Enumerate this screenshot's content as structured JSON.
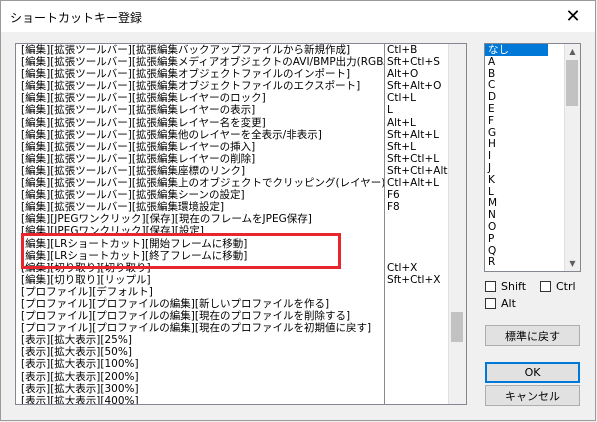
{
  "window": {
    "title": "ショートカットキー登録",
    "close_glyph": "✕"
  },
  "commands": [
    {
      "cmd": "[編集][拡張ツールバー][拡張編集バックアップファイルから新規作成]",
      "key": "Ctl+B"
    },
    {
      "cmd": "[編集][拡張ツールバー][拡張編集メディアオブジェクトのAVI/BMP出力(RGBA)]",
      "key": "Sft+Ctl+S"
    },
    {
      "cmd": "[編集][拡張ツールバー][拡張編集オブジェクトファイルのインポート]",
      "key": "Alt+O"
    },
    {
      "cmd": "[編集][拡張ツールバー][拡張編集オブジェクトファイルのエクスポート]",
      "key": "Sft+Alt+O"
    },
    {
      "cmd": "[編集][拡張ツールバー][拡張編集レイヤーのロック]",
      "key": "Ctl+L"
    },
    {
      "cmd": "[編集][拡張ツールバー][拡張編集レイヤーの表示]",
      "key": "L"
    },
    {
      "cmd": "[編集][拡張ツールバー][拡張編集レイヤー名を変更]",
      "key": "Alt+L"
    },
    {
      "cmd": "[編集][拡張ツールバー][拡張編集他のレイヤーを全表示/非表示]",
      "key": "Sft+Alt+L"
    },
    {
      "cmd": "[編集][拡張ツールバー][拡張編集レイヤーの挿入]",
      "key": "Sft+L"
    },
    {
      "cmd": "[編集][拡張ツールバー][拡張編集レイヤーの削除]",
      "key": "Sft+Ctl+L"
    },
    {
      "cmd": "[編集][拡張ツールバー][拡張編集座標のリンク]",
      "key": "Sft+Ctl+Alt+"
    },
    {
      "cmd": "[編集][拡張ツールバー][拡張編集上のオブジェクトでクリッピング(レイヤー)]",
      "key": "Ctl+Alt+L"
    },
    {
      "cmd": "[編集][拡張ツールバー][拡張編集シーンの設定]",
      "key": "F6"
    },
    {
      "cmd": "[編集][拡張ツールバー][拡張編集環境設定]",
      "key": "F8"
    },
    {
      "cmd": "[編集][JPEGワンクリック][保存][現在のフレームをJPEG保存]",
      "key": ""
    },
    {
      "cmd": "[編集][JPEGワンクリック][保存][設定]",
      "key": ""
    },
    {
      "cmd": "[編集][LRショートカット][開始フレームに移動]",
      "key": ""
    },
    {
      "cmd": "[編集][LRショートカット][終了フレームに移動]",
      "key": ""
    },
    {
      "cmd": "[編集][切り取り][切り取り]",
      "key": "Ctl+X"
    },
    {
      "cmd": "[編集][切り取り][リップル]",
      "key": "Sft+Ctl+X"
    },
    {
      "cmd": "[プロファイル][デフォルト]",
      "key": ""
    },
    {
      "cmd": "[プロファイル][プロファイルの編集][新しいプロファイルを作る]",
      "key": ""
    },
    {
      "cmd": "[プロファイル][プロファイルの編集][現在のプロファイルを削除する]",
      "key": ""
    },
    {
      "cmd": "[プロファイル][プロファイルの編集][現在のプロファイルを初期値に戻す]",
      "key": ""
    },
    {
      "cmd": "[表示][拡大表示][25%]",
      "key": ""
    },
    {
      "cmd": "[表示][拡大表示][50%]",
      "key": ""
    },
    {
      "cmd": "[表示][拡大表示][100%]",
      "key": ""
    },
    {
      "cmd": "[表示][拡大表示][200%]",
      "key": ""
    },
    {
      "cmd": "[表示][拡大表示][300%]",
      "key": ""
    },
    {
      "cmd": "[表示][拡大表示][400%]",
      "key": ""
    }
  ],
  "keys": [
    "なし",
    "A",
    "B",
    "C",
    "D",
    "E",
    "F",
    "G",
    "H",
    "I",
    "J",
    "K",
    "L",
    "M",
    "N",
    "O",
    "P",
    "Q",
    "R"
  ],
  "selected_key": "なし",
  "modifiers": {
    "shift": "Shift",
    "ctrl": "Ctrl",
    "alt": "Alt"
  },
  "buttons": {
    "reset": "標準に戻す",
    "ok": "OK",
    "cancel": "キャンセル"
  },
  "colors": {
    "highlight": "#e8262d",
    "selection": "#0078d7"
  }
}
